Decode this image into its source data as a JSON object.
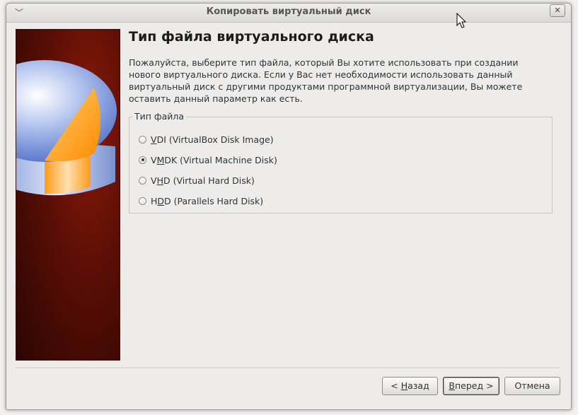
{
  "window": {
    "title": "Копировать виртуальный диск"
  },
  "page": {
    "title": "Тип файла виртуального диска",
    "description": "Пожалуйста, выберите тип файла, который Вы хотите использовать при создании\nнового виртуального диска. Если у Вас нет необходимости использовать данный\nвиртуальный диск с другими продуктами программной виртуализации, Вы можете\nоставить данный параметр как есть."
  },
  "file_type_group": {
    "legend": "Тип файла",
    "options": [
      {
        "mnemonic": "V",
        "rest": "DI (VirtualBox Disk Image)",
        "selected": false
      },
      {
        "pre": "V",
        "mnemonic": "M",
        "rest": "DK (Virtual Machine Disk)",
        "selected": true
      },
      {
        "pre": "V",
        "mnemonic": "H",
        "rest": "D (Virtual Hard Disk)",
        "selected": false
      },
      {
        "pre": "H",
        "mnemonic": "D",
        "rest": "D (Parallels Hard Disk)",
        "selected": false
      }
    ]
  },
  "buttons": {
    "back": {
      "prefix": "< ",
      "mnemonic": "Н",
      "rest": "азад"
    },
    "next": {
      "mnemonic": "В",
      "rest": "перед >"
    },
    "cancel": {
      "label": "Отмена"
    }
  },
  "colors": {
    "window_bg": "#edeceb",
    "sidebar_bg": "#5a0e05",
    "disk_blue": "#6f8fd8",
    "disk_orange": "#ff9a1a"
  }
}
